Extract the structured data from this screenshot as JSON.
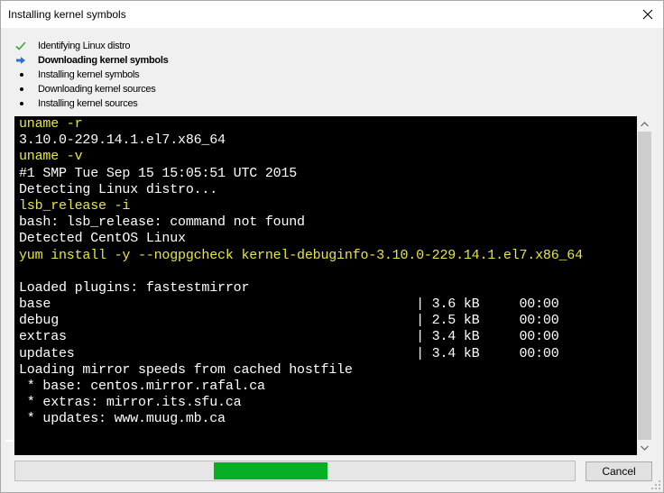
{
  "window": {
    "title": "Installing kernel symbols"
  },
  "steps": [
    {
      "label": "Identifying Linux distro",
      "status": "done",
      "icon": "check-icon"
    },
    {
      "label": "Downloading kernel symbols",
      "status": "current",
      "icon": "arrow-right-icon"
    },
    {
      "label": "Installing kernel symbols",
      "status": "pending",
      "icon": "bullet-icon"
    },
    {
      "label": "Downloading kernel sources",
      "status": "pending",
      "icon": "bullet-icon"
    },
    {
      "label": "Installing kernel sources",
      "status": "pending",
      "icon": "bullet-icon"
    }
  ],
  "console": {
    "lines": [
      {
        "text": "uname -r",
        "kind": "cmd"
      },
      {
        "text": "3.10.0-229.14.1.el7.x86_64",
        "kind": "out"
      },
      {
        "text": "uname -v",
        "kind": "cmd"
      },
      {
        "text": "#1 SMP Tue Sep 15 15:05:51 UTC 2015",
        "kind": "out"
      },
      {
        "text": "Detecting Linux distro...",
        "kind": "out"
      },
      {
        "text": "lsb_release -i",
        "kind": "cmd"
      },
      {
        "text": "bash: lsb_release: command not found",
        "kind": "out"
      },
      {
        "text": "Detected CentOS Linux",
        "kind": "out"
      },
      {
        "text": "yum install -y --nogpgcheck kernel-debuginfo-3.10.0-229.14.1.el7.x86_64",
        "kind": "cmd"
      },
      {
        "text": "",
        "kind": "out"
      },
      {
        "text": "Loaded plugins: fastestmirror",
        "kind": "out"
      },
      {
        "text": "base                                              | 3.6 kB     00:00",
        "kind": "out"
      },
      {
        "text": "debug                                             | 2.5 kB     00:00",
        "kind": "out"
      },
      {
        "text": "extras                                            | 3.4 kB     00:00",
        "kind": "out"
      },
      {
        "text": "updates                                           | 3.4 kB     00:00",
        "kind": "out"
      },
      {
        "text": "Loading mirror speeds from cached hostfile",
        "kind": "out"
      },
      {
        "text": " * base: centos.mirror.rafal.ca",
        "kind": "out"
      },
      {
        "text": " * extras: mirror.its.sfu.ca",
        "kind": "out"
      },
      {
        "text": " * updates: www.muug.mb.ca",
        "kind": "out"
      }
    ],
    "colors": {
      "background": "#000000",
      "command": "#e8e640",
      "output": "#ffffff"
    }
  },
  "progress": {
    "mode": "marquee",
    "segment_start": 0.355,
    "segment_end": 0.558,
    "color": "#06b025"
  },
  "buttons": {
    "cancel": "Cancel"
  }
}
